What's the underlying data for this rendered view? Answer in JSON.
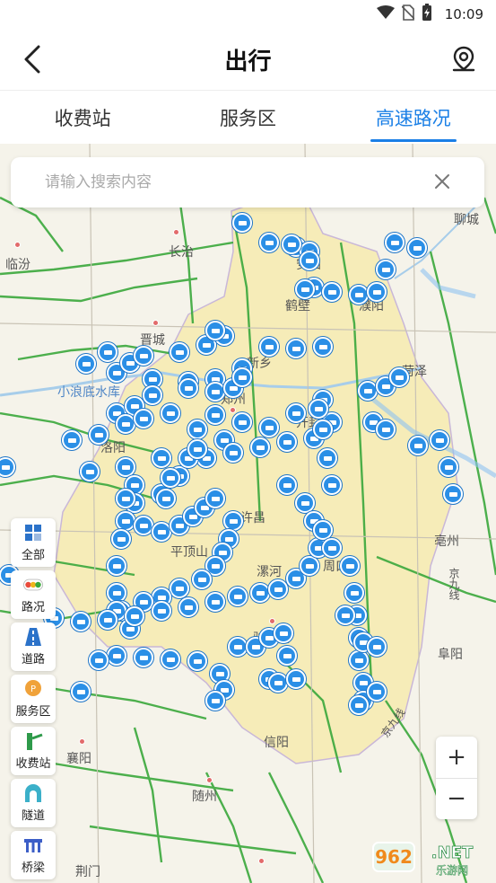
{
  "status_bar": {
    "time": "10:09"
  },
  "nav": {
    "title": "出行"
  },
  "tabs": [
    {
      "label": "收费站",
      "active": false
    },
    {
      "label": "服务区",
      "active": false
    },
    {
      "label": "高速路况",
      "active": true
    }
  ],
  "search": {
    "placeholder": "请输入搜索内容",
    "value": ""
  },
  "side_panel": [
    {
      "label": "全部",
      "icon": "grid-icon"
    },
    {
      "label": "路况",
      "icon": "traffic-light-icon"
    },
    {
      "label": "道路",
      "icon": "road-icon"
    },
    {
      "label": "服务区",
      "icon": "service-area-icon"
    },
    {
      "label": "收费站",
      "icon": "toll-gate-icon"
    },
    {
      "label": "隧道",
      "icon": "tunnel-icon"
    },
    {
      "label": "桥梁",
      "icon": "bridge-icon"
    }
  ],
  "zoom": {
    "in_label": "+",
    "out_label": "−"
  },
  "map": {
    "cities": [
      "临汾",
      "长治",
      "安阳",
      "鹤壁",
      "濮阳",
      "聊城",
      "晋城",
      "新乡",
      "小浪底水库",
      "郑州",
      "开封",
      "菏泽",
      "洛阳",
      "许昌",
      "平顶山",
      "漯河",
      "周口",
      "亳州",
      "驻马店",
      "阜阳",
      "信阳",
      "襄阳",
      "随州",
      "荆门",
      "京九线",
      "京九线"
    ],
    "watermark": "962.NET 乐游网"
  },
  "colors": {
    "accent": "#1a7fe6",
    "camera": "#2b8fe6",
    "road_free": "#38b03a",
    "province": "#f6ecb8"
  }
}
